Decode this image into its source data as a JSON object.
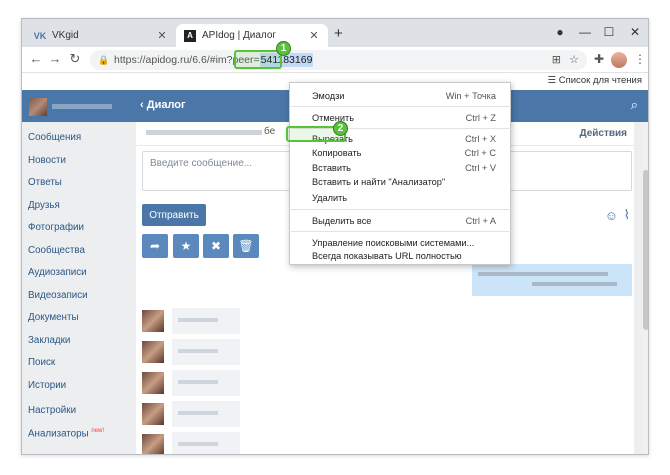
{
  "tabs": [
    {
      "label": "VKgid",
      "favicon": "VK"
    },
    {
      "label": "APIdog | Диалог",
      "favicon": "A"
    }
  ],
  "url": {
    "prefix": "https://apidog.ru/6.6/#im?peer=",
    "selected": "541183169"
  },
  "bookmarks": {
    "reading_list": "Список для чтения"
  },
  "header": {
    "title": "Диалог"
  },
  "sidebar": {
    "items": [
      "Сообщения",
      "Новости",
      "Ответы",
      "Друзья",
      "Фотографии",
      "Сообщества",
      "Аудиозаписи",
      "Видеозаписи",
      "Документы",
      "Закладки",
      "Поиск",
      "Истории",
      "Настройки",
      "Анализаторы"
    ],
    "new_badge": "new!"
  },
  "dialog": {
    "actions": "Действия",
    "partial_name": "бе",
    "input_placeholder": "Введите сообщение...",
    "send_label": "Отправить"
  },
  "context_menu": {
    "items": [
      {
        "label": "Эмодзи",
        "shortcut": "Win + Точка"
      },
      {
        "label": "Отменить",
        "shortcut": "Ctrl + Z"
      },
      {
        "label": "Вырезать",
        "shortcut": "Ctrl + X"
      },
      {
        "label": "Копировать",
        "shortcut": "Ctrl + C"
      },
      {
        "label": "Вставить",
        "shortcut": "Ctrl + V"
      },
      {
        "label": "Вставить и найти \"Анализатор\"",
        "shortcut": ""
      },
      {
        "label": "Удалить",
        "shortcut": ""
      },
      {
        "label": "Выделить все",
        "shortcut": "Ctrl + A"
      },
      {
        "label": "Управление поисковыми системами...",
        "shortcut": ""
      },
      {
        "label": "Всегда показывать URL полностью",
        "shortcut": ""
      }
    ]
  },
  "badges": {
    "step1": "1",
    "step2": "2"
  },
  "colors": {
    "vk_blue": "#4a76a8",
    "highlight_green": "#5ac13b",
    "selection": "#c2d9f8"
  }
}
